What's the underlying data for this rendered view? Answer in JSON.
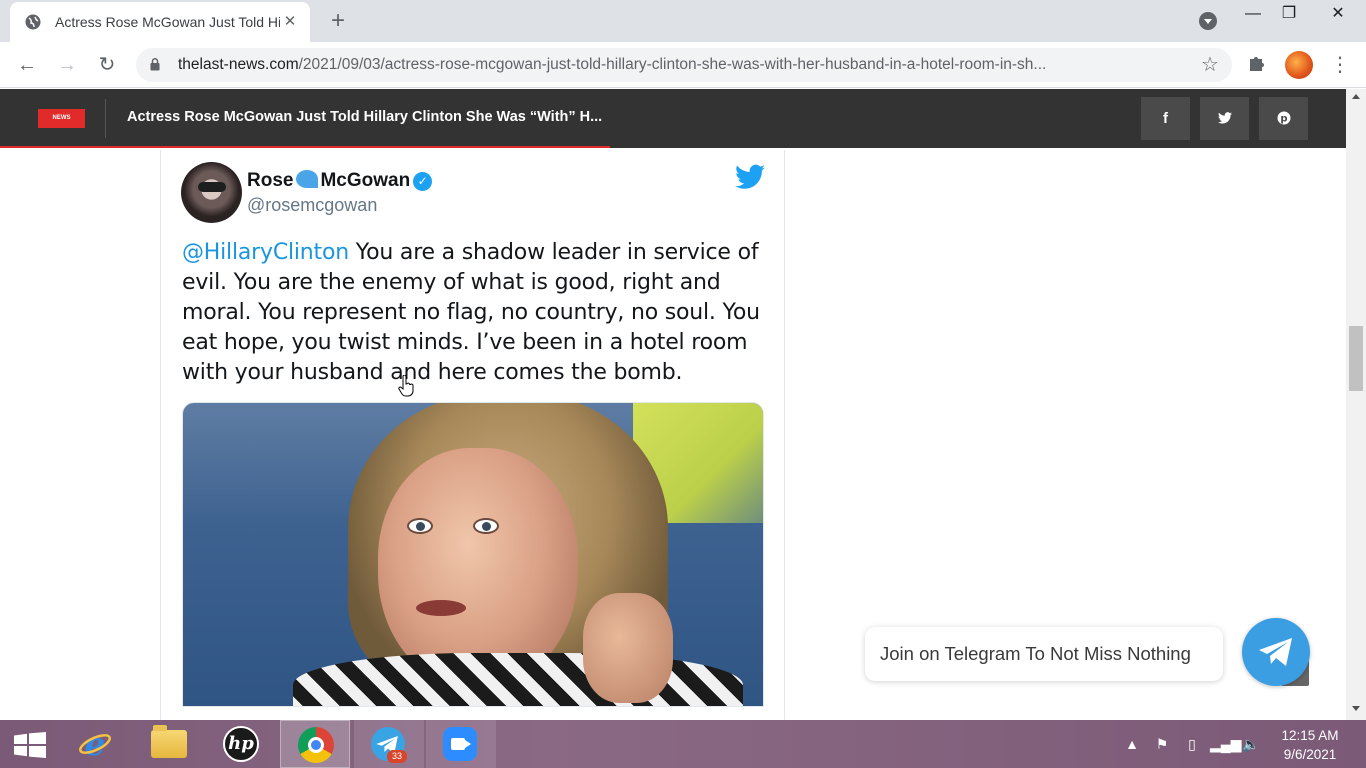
{
  "browser": {
    "tab_title": "Actress Rose McGowan Just Told Hillary Clinton She Was “With” Her Husband In A Hotel Room",
    "url_host": "thelast-news.com",
    "url_path": "/2021/09/03/actress-rose-mcgowan-just-told-hillary-clinton-she-was-with-her-husband-in-a-hotel-room-in-sh..."
  },
  "site": {
    "logo_text": "NEWS",
    "header_title": "Actress Rose McGowan Just Told Hillary Clinton She Was “With” H...",
    "social": {
      "facebook": "f",
      "twitter": "t",
      "pinterest": "p"
    },
    "accent_color": "#e12a2a"
  },
  "tweet": {
    "name_first": "Rose",
    "name_last": "McGowan",
    "handle": "@rosemcgowan",
    "mention": "@HillaryClinton",
    "text": " You are a shadow leader in service of evil. You are the enemy of what is good, right and moral. You represent no flag, no country, no soul. You eat hope, you twist minds. I’ve been in a hotel room with your husband and here comes the bomb."
  },
  "telegram_widget": {
    "label": "Join on Telegram To Not Miss Nothing",
    "color": "#3b9de2"
  },
  "taskbar": {
    "telegram_badge": "33",
    "time": "12:15 AM",
    "date": "9/6/2021"
  }
}
